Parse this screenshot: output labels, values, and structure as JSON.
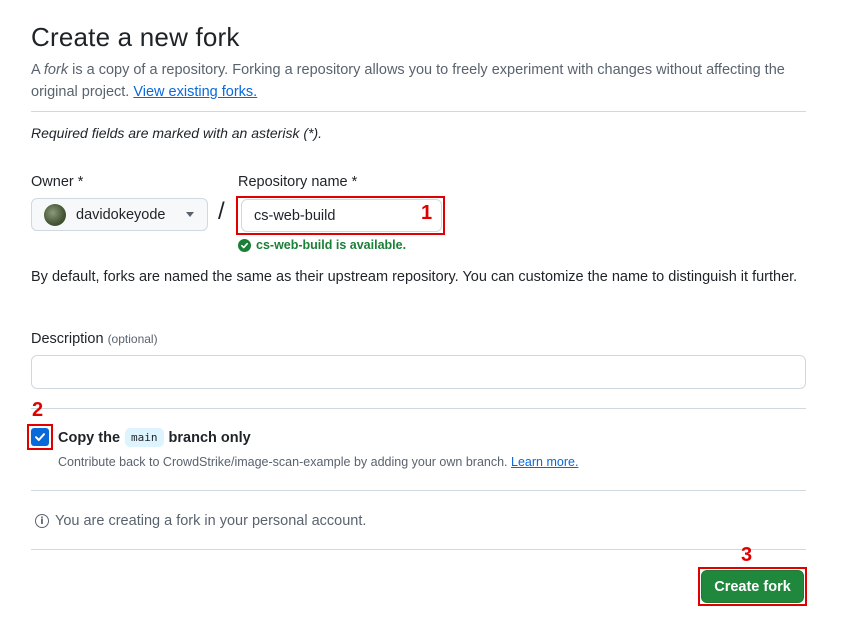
{
  "page": {
    "title": "Create a new fork",
    "intro_prefix": "A ",
    "intro_fork_word": "fork",
    "intro_rest": " is a copy of a repository. Forking a repository allows you to freely experiment with changes without affecting the original project. ",
    "intro_link": "View existing forks.",
    "required_note": "Required fields are marked with an asterisk (*)."
  },
  "owner": {
    "label": "Owner *",
    "selected": "davidokeyode"
  },
  "repo": {
    "label": "Repository name *",
    "value": "cs-web-build",
    "availability": "cs-web-build is available."
  },
  "separator": "/",
  "default_note": "By default, forks are named the same as their upstream repository. You can customize the name to distinguish it further.",
  "description": {
    "label": "Description",
    "optional": "(optional)",
    "value": ""
  },
  "copy_branch": {
    "checked": true,
    "label_before": "Copy the",
    "branch": "main",
    "label_after": "branch only",
    "contrib_text": "Contribute back to CrowdStrike/image-scan-example by adding your own branch. ",
    "learn_more": "Learn more."
  },
  "personal_note": "You are creating a fork in your personal account.",
  "create_button": "Create fork",
  "annotations": {
    "one": "1",
    "two": "2",
    "three": "3"
  },
  "colors": {
    "primary_button": "#1f883d",
    "link": "#0969da",
    "success": "#1a7f37",
    "annotation_red": "#e00000"
  }
}
